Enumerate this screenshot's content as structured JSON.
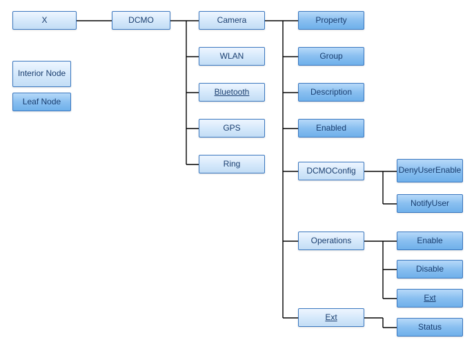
{
  "legend": {
    "interior": "Interior Node",
    "leaf": "Leaf Node"
  },
  "tree": {
    "x": "X",
    "dcmo": "DCMO",
    "camera": "Camera",
    "wlan": "WLAN",
    "bluetooth": "Bluetooth",
    "gps": "GPS",
    "ring": "Ring"
  },
  "props": {
    "property": "Property",
    "group": "Group",
    "description": "Description",
    "enabled": "Enabled",
    "dcmoconfig": "DCMOConfig",
    "operations": "Operations",
    "ext": "Ext"
  },
  "dcmo_cfg": {
    "deny": "DenyUserEnable",
    "notify": "NotifyUser"
  },
  "ops": {
    "enable": "Enable",
    "disable": "Disable",
    "ext": "Ext"
  },
  "ext": {
    "status": "Status"
  }
}
